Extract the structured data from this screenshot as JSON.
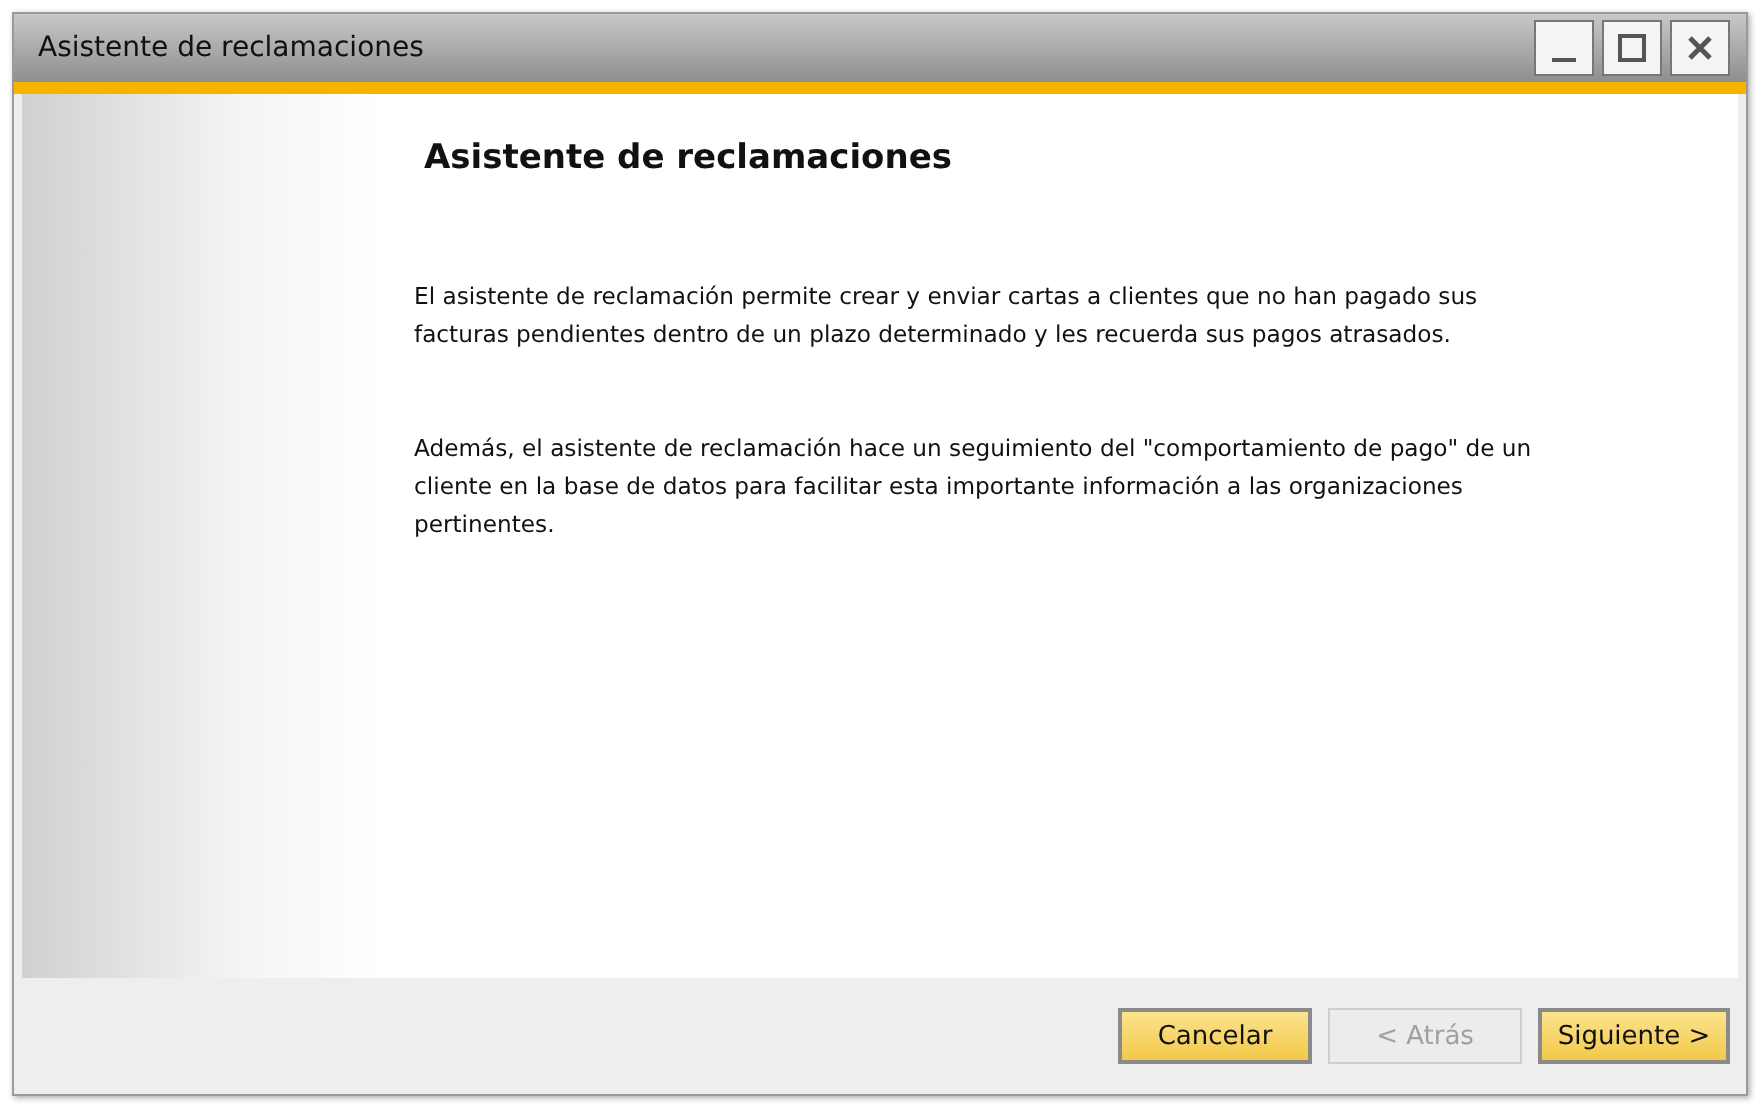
{
  "window": {
    "title": "Asistente de reclamaciones"
  },
  "heading": "Asistente de reclamaciones",
  "paragraphs": [
    "El asistente de reclamación permite crear y enviar cartas a clientes que no han pagado sus facturas pendientes dentro de un plazo determinado y les recuerda sus pagos atrasados.",
    "Además, el asistente de reclamación hace un seguimiento del \"comportamiento de pago\" de un cliente en la base de datos para facilitar esta importante información a las organizaciones pertinentes."
  ],
  "buttons": [
    {
      "label": "Cancelar",
      "disabled": false
    },
    {
      "label": "< Atrás",
      "disabled": true
    },
    {
      "label": "Siguiente >",
      "disabled": false
    }
  ]
}
